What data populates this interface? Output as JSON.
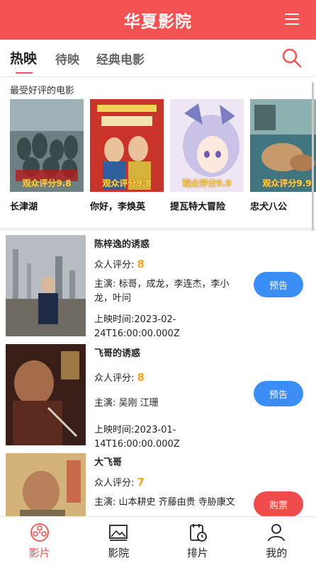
{
  "header": {
    "title": "华夏影院"
  },
  "tabs": [
    {
      "label": "热映"
    },
    {
      "label": "待映"
    },
    {
      "label": "经典电影"
    }
  ],
  "top_rated": {
    "title": "最受好评的电影",
    "movies": [
      {
        "name": "长津湖",
        "score": "观众评分9.8",
        "bg": "#5b6e72"
      },
      {
        "name": "你好，李焕英",
        "score": "观众评分9.8",
        "bg": "#c8342a"
      },
      {
        "name": "提瓦特大冒险",
        "score": "观众评分9.9",
        "bg": "#e8dff1"
      },
      {
        "name": "忠犬八公",
        "score": "观众评分9.9",
        "bg": "#3f7680"
      }
    ]
  },
  "movie_list": [
    {
      "name": "陈梓逸的诱惑",
      "score_label": "众人评分:",
      "score": "8",
      "cast": "主演: 标哥，成龙，李连杰，李小龙，叶问",
      "release": "上映时间:2023-02-24T16:00:00.000Z",
      "button": "预告",
      "button_color": "#3b8ef5"
    },
    {
      "name": "飞哥的诱惑",
      "score_label": "众人评分:",
      "score": "8",
      "cast": "主演: 吴刚 江珊",
      "release": "上映时间:2023-01-14T16:00:00.000Z",
      "button": "预告",
      "button_color": "#3b8ef5"
    },
    {
      "name": "大飞哥",
      "score_label": "众人评分:",
      "score": "7",
      "cast": "主演: 山本耕史 齐藤由贵 寺胁康文",
      "release": "",
      "button": "购票",
      "button_color": "#ef4b4b"
    }
  ],
  "bottom_nav": [
    {
      "label": "影片",
      "icon": "film-reel-icon",
      "active": true
    },
    {
      "label": "影院",
      "icon": "cinema-screen-icon",
      "active": false
    },
    {
      "label": "排片",
      "icon": "schedule-icon",
      "active": false
    },
    {
      "label": "我的",
      "icon": "user-icon",
      "active": false
    }
  ],
  "colors": {
    "brand": "#f25252",
    "button_blue": "#3b8ef5",
    "score_orange": "#f5a524"
  }
}
